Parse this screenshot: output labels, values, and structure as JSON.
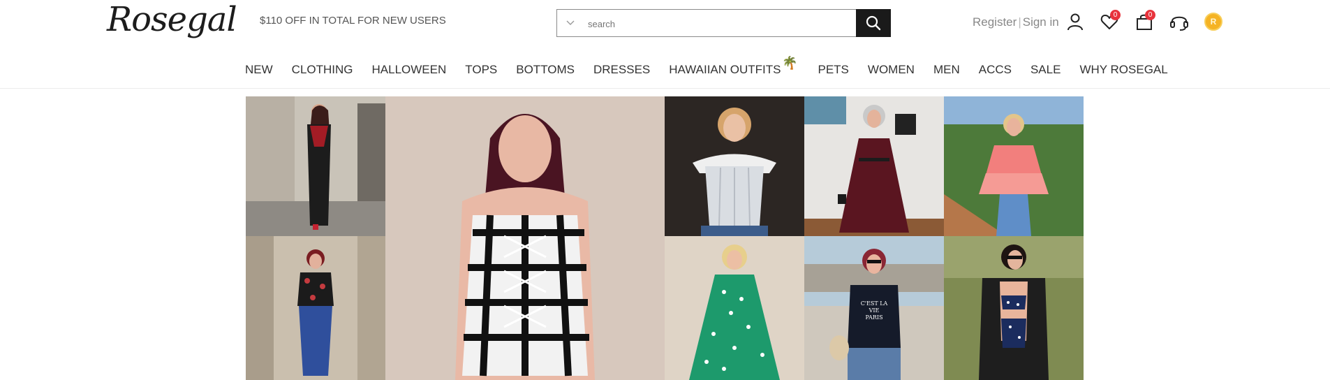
{
  "header": {
    "logo_text": "Rosegal",
    "promo": "$110 OFF IN TOTAL FOR NEW USERS",
    "search_placeholder": "search",
    "register": "Register",
    "separator": "|",
    "signin": "Sign in",
    "wishlist_count": "0",
    "cart_count": "0",
    "coin_letter": "R"
  },
  "nav": {
    "items": [
      "NEW",
      "CLOTHING",
      "HALLOWEEN",
      "TOPS",
      "BOTTOMS",
      "DRESSES",
      "HAWAIIAN OUTFITS",
      "PETS",
      "WOMEN",
      "MEN",
      "ACCS",
      "SALE",
      "WHY ROSEGAL"
    ]
  },
  "icons": {
    "search": "magnifier-icon",
    "user": "user-icon",
    "wishlist": "heart-icon",
    "cart": "bag-icon",
    "support": "headset-icon",
    "coin": "coin-icon",
    "palm": "palm-tree-icon"
  },
  "colors": {
    "accent": "#1a1a1a",
    "badge": "#e8333c",
    "coin": "#f5b324"
  },
  "gallery": {
    "photos": [
      "model-black-red-dress",
      "model-plaid-corset-top",
      "model-white-corset",
      "model-burgundy-maxi-dress",
      "model-pink-ruffle-top",
      "model-floral-blouse-jeans",
      "model-green-polka-dress",
      "model-black-tee-paris",
      "model-printed-bikini"
    ]
  }
}
